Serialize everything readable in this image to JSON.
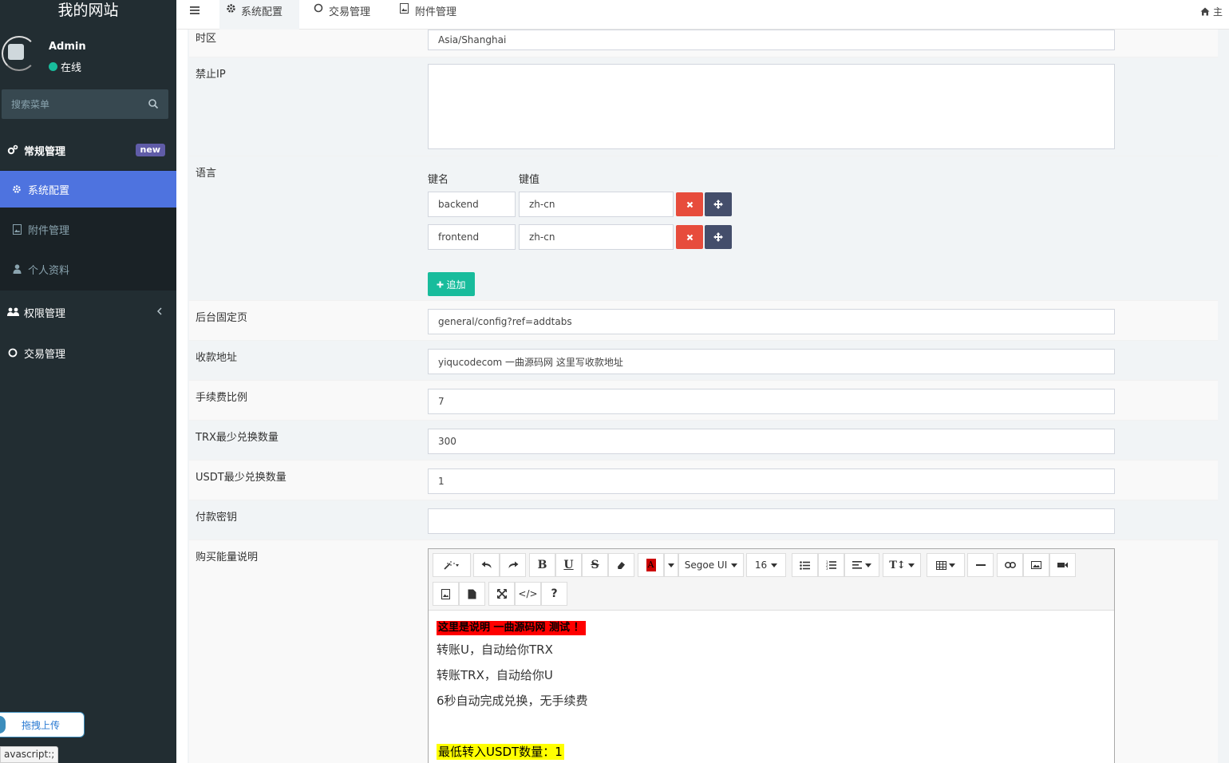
{
  "site": {
    "title": "我的网站"
  },
  "user": {
    "name": "Admin",
    "status": "在线"
  },
  "search": {
    "placeholder": "搜索菜单"
  },
  "sidebar": {
    "general": "常规管理",
    "general_badge": "new",
    "config": "系统配置",
    "attachment": "附件管理",
    "profile": "个人资料",
    "auth": "权限管理",
    "trade": "交易管理"
  },
  "upload": {
    "label": "拖拽上传"
  },
  "status_bar": {
    "text": "avascript:;"
  },
  "tabs": {
    "config": "系统配置",
    "trade": "交易管理",
    "attachment": "附件管理"
  },
  "topbar": {
    "home_label": "主"
  },
  "form": {
    "timezone": {
      "label": "时区",
      "value": "Asia/Shanghai"
    },
    "forbidden_ip": {
      "label": "禁止IP",
      "value": ""
    },
    "language": {
      "label": "语言",
      "key_header": "键名",
      "value_header": "键值",
      "rows": [
        {
          "key": "backend",
          "value": "zh-cn"
        },
        {
          "key": "frontend",
          "value": "zh-cn"
        }
      ],
      "add_label": "追加"
    },
    "fixed_page": {
      "label": "后台固定页",
      "value": "general/config?ref=addtabs"
    },
    "address": {
      "label": "收款地址",
      "value": "yiqucodecom 一曲源码网 这里写收款地址"
    },
    "fee": {
      "label": "手续费比例",
      "value": "7"
    },
    "trx_min": {
      "label": "TRX最少兑换数量",
      "value": "300"
    },
    "usdt_min": {
      "label": "USDT最少兑换数量",
      "value": "1"
    },
    "pay_key": {
      "label": "付款密钥",
      "value": ""
    },
    "buy_desc": {
      "label": "购买能量说明",
      "toolbar": {
        "font": "Segoe UI",
        "size": "16"
      },
      "content": {
        "line1": "这里是说明 一曲源码网 测试 ！",
        "line2": "转账U，自动给你TRX",
        "line3": "转账TRX，自动给你U",
        "line4": "6秒自动完成兑换，无手续费",
        "line5": "最低转入USDT数量：1"
      }
    }
  },
  "colors": {
    "sidebar": "#222d32",
    "active": "#4e73df",
    "danger": "#e74c3c",
    "success": "#18bc9c",
    "move": "#444e6b"
  }
}
